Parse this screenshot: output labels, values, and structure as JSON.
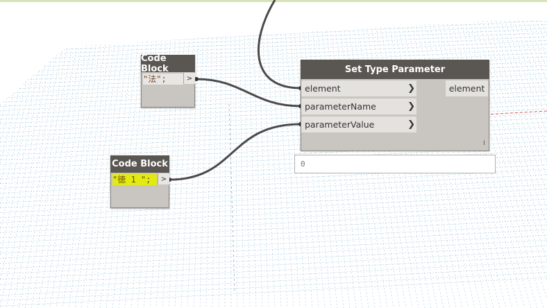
{
  "colors": {
    "node_header": "#5a5652",
    "node_body": "#c9c5c0",
    "wire": "#4a4a4a",
    "highlight": "#e3ea12",
    "grid": "#9ec9da"
  },
  "code_block_1": {
    "title": "Code Block",
    "code": "\"法\";",
    "output_port": ">"
  },
  "code_block_2": {
    "title": "Code Block",
    "code": "\"徳 1 \";",
    "output_port": ">"
  },
  "set_type_parameter": {
    "title": "Set Type Parameter",
    "inputs": [
      {
        "label": "element",
        "icon": "chevron-right-icon"
      },
      {
        "label": "parameterName",
        "icon": "chevron-right-icon"
      },
      {
        "label": "parameterValue",
        "icon": "chevron-right-icon"
      }
    ],
    "output": "element",
    "lacing": "I",
    "preview_value": "0"
  }
}
